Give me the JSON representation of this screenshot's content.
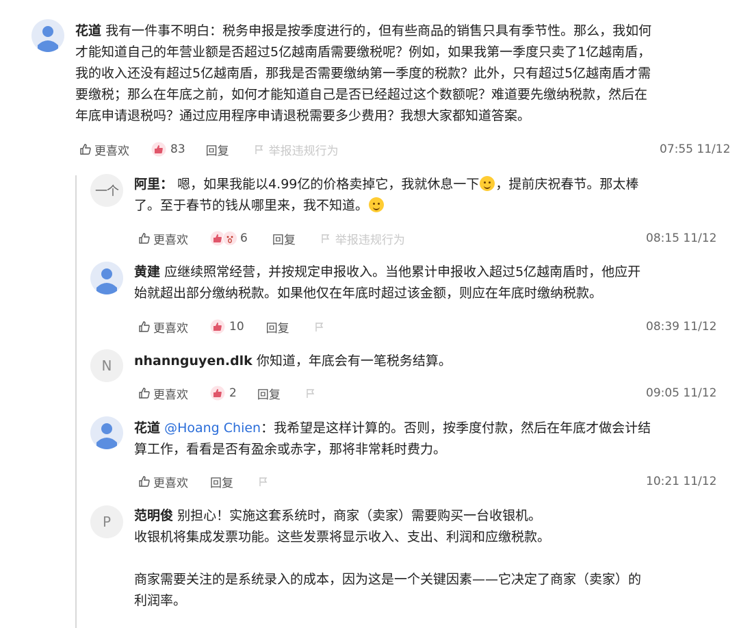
{
  "actions": {
    "like": "更喜欢",
    "reply": "回复",
    "report": "举报违规行为"
  },
  "colors": {
    "mention": "#2a6dd9",
    "like_reaction": "#e0566a",
    "avatar_person": "#5b8ee0"
  },
  "main": {
    "author": "花道",
    "text_lines": [
      "我有一件事不明白：税务申报是按季度进行的，但有些商品的销售只具有季节性。那么，我如何",
      "才能知道自己的年营业额是否超过5亿越南盾需要缴税呢？例如，如果我第一季度只卖了1亿越南盾，",
      "我的收入还没有超过5亿越南盾，那我是否需要缴纳第一季度的税款？此外，只有超过5亿越南盾才需",
      "要缴税；那么在年底之前，如何才能知道自己是否已经超过这个数额呢？难道要先缴纳税款，然后在",
      "年底申请退税吗？通过应用程序申请退税需要多少费用？我想大家都知道答案。"
    ],
    "reactions": "83",
    "time": "07:55 11/12"
  },
  "replies": {
    "r1": {
      "avatar_text": "一个",
      "author": "阿里",
      "sep": "：",
      "line1_a": "嗯，如果我能以4.99亿的价格卖掉它，我就休息一下",
      "line1_b": "，提前庆祝春节。那太棒",
      "line2": "了。至于春节的钱从哪里来，我不知道。",
      "reactions": "6",
      "time": "08:15 11/12"
    },
    "r2": {
      "author": "黄建",
      "lines": [
        "应继续照常经营，并按规定申报收入。当他累计申报收入超过5亿越南盾时，他应开",
        "始就超出部分缴纳税款。如果他仅在年底时超过该金额，则应在年底时缴纳税款。"
      ],
      "reactions": "10",
      "time": "08:39 11/12"
    },
    "r3": {
      "avatar_text": "N",
      "author": "nhannguyen.dlk",
      "text": "你知道，年底会有一笔税务结算。",
      "reactions": "2",
      "time": "09:05 11/12"
    },
    "r4": {
      "author": "花道",
      "mention": "@Hoang Chien",
      "line1": "：我希望是这样计算的。否则，按季度付款，然后在年底才做会计结",
      "line2": "算工作，看看是否有盈余或赤字，那将非常耗时费力。",
      "time": "10:21 11/12"
    },
    "r5": {
      "avatar_text": "P",
      "author": "范明俊",
      "lines": [
        "别担心！实施这套系统时，商家（卖家）需要购买一台收银机。",
        "收银机将集成发票功能。这些发票将显示收入、支出、利润和应缴税款。",
        "",
        "商家需要关注的是系统录入的成本，因为这是一个关键因素——它决定了商家（卖家）的",
        "利润率。"
      ]
    }
  }
}
